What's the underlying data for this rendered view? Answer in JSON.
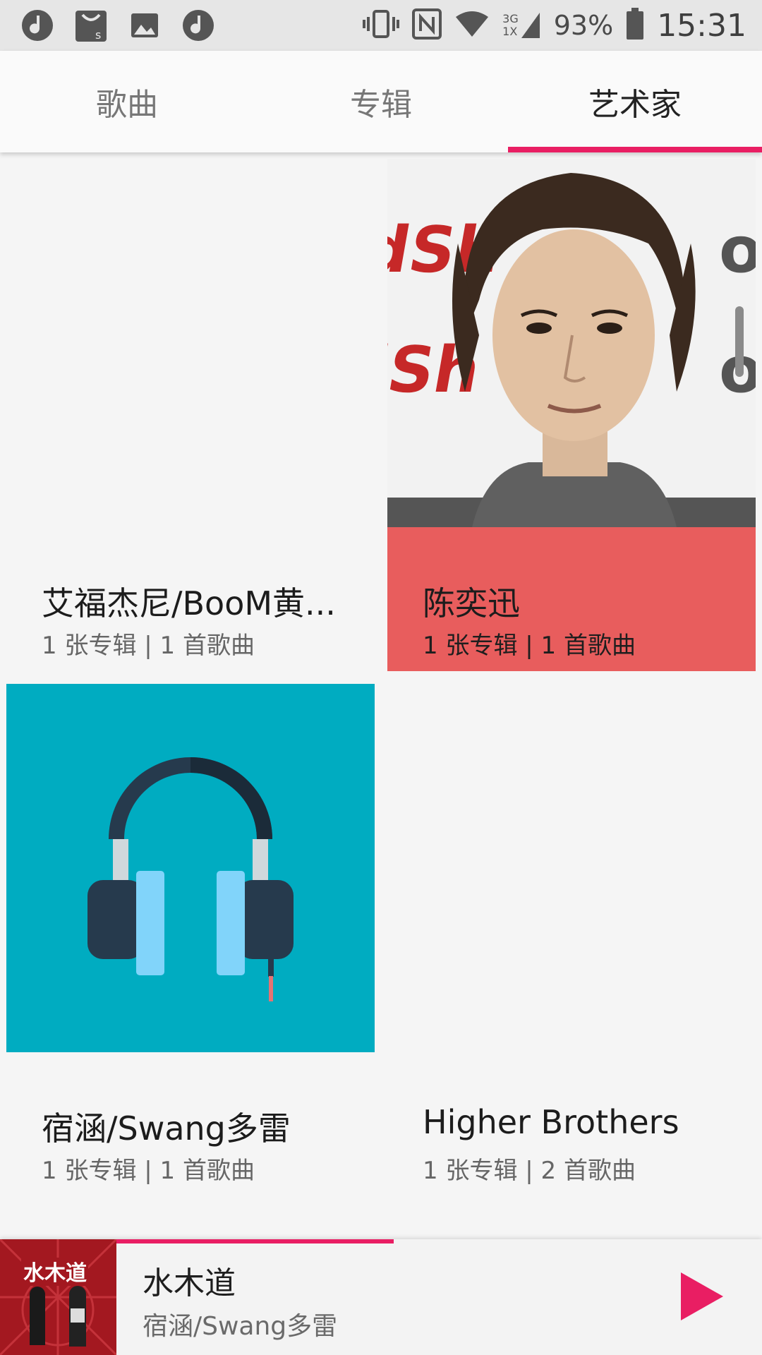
{
  "status_bar": {
    "left_icons": [
      "music-note-icon",
      "shopping-bag-icon",
      "image-icon",
      "music-note-icon"
    ],
    "right_icons": [
      "vibrate-icon",
      "nfc-icon",
      "wifi-icon",
      "signal-icon",
      "battery-icon"
    ],
    "network_top": "3G",
    "network_bottom": "1X",
    "battery": "93%",
    "time": "15:31"
  },
  "tabs": [
    {
      "label": "歌曲",
      "active": false
    },
    {
      "label": "专辑",
      "active": false
    },
    {
      "label": "艺术家",
      "active": true
    }
  ],
  "artists": [
    {
      "name": "艾福杰尼/BooM黄...",
      "meta": "1 张专辑 | 1 首歌曲",
      "art": "blank"
    },
    {
      "name": "陈奕迅",
      "meta": "1 张专辑 | 1 首歌曲",
      "art": "photo"
    },
    {
      "name": "宿涵/Swang多雷",
      "meta": "1 张专辑 | 1 首歌曲",
      "art": "headphones-icon"
    },
    {
      "name": "Higher Brothers",
      "meta": "1 张专辑 | 2 首歌曲",
      "art": "blank"
    }
  ],
  "colors": {
    "accent": "#e91e63",
    "highlight": "#e85d5d",
    "headphone_bg": "#00acc1"
  },
  "now_playing": {
    "title": "水木道",
    "artist": "宿涵/Swang多雷",
    "cover_text": "水木道",
    "progress": 0.43
  }
}
